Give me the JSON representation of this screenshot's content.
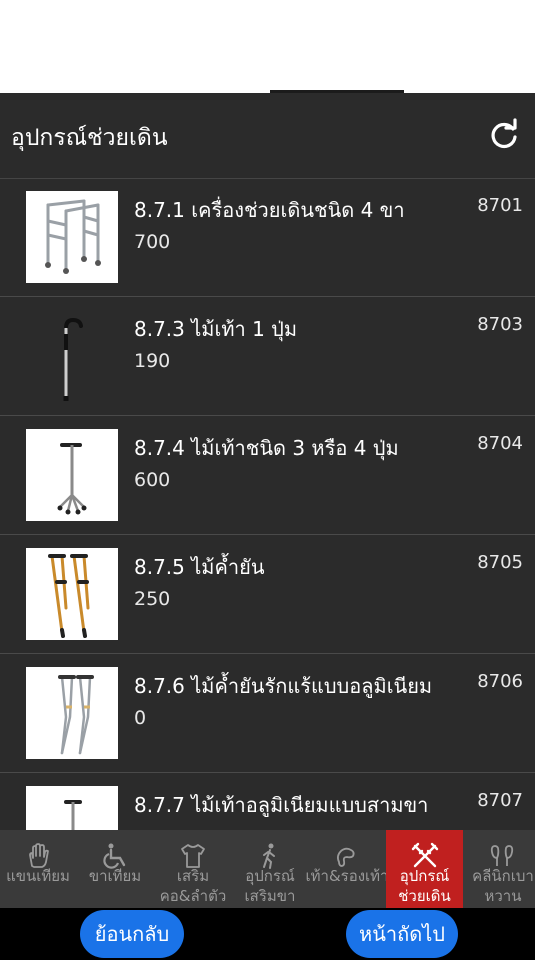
{
  "header": {
    "title": "อุปกรณ์ช่วยเดิน"
  },
  "items": [
    {
      "name": "8.7.1 เครื่องช่วยเดินชนิด 4 ขา",
      "price": "700",
      "code": "8701"
    },
    {
      "name": "8.7.3 ไม้เท้า 1 ปุ่ม",
      "price": "190",
      "code": "8703"
    },
    {
      "name": "8.7.4 ไม้เท้าชนิด 3 หรือ 4 ปุ่ม",
      "price": "600",
      "code": "8704"
    },
    {
      "name": "8.7.5 ไม้ค้ำยัน",
      "price": "250",
      "code": "8705"
    },
    {
      "name": "8.7.6 ไม้ค้ำยันรักแร้แบบอลูมิเนียม",
      "price": "0",
      "code": "8706"
    },
    {
      "name": "8.7.7 ไม้เท้าอลูมิเนียมแบบสามขา",
      "price": "",
      "code": "8707"
    }
  ],
  "tabs": [
    {
      "label1": "แขนเทียม",
      "label2": "",
      "icon": "hand-icon"
    },
    {
      "label1": "ขาเทียม",
      "label2": "",
      "icon": "wheelchair-icon"
    },
    {
      "label1": "เสริม",
      "label2": "คอ&ลำตัว",
      "icon": "shirt-icon"
    },
    {
      "label1": "อุปกรณ์",
      "label2": "เสริมขา",
      "icon": "walking-person-icon"
    },
    {
      "label1": "เท้า&รองเท้า",
      "label2": "",
      "icon": "foot-icon"
    },
    {
      "label1": "อุปกรณ์",
      "label2": "ช่วยเดิน",
      "icon": "crossed-crutches-icon",
      "active": true
    },
    {
      "label1": "คลีนิกเบา",
      "label2": "หวาน",
      "icon": "clinic-icon"
    }
  ],
  "buttons": {
    "back": "ย้อนกลับ",
    "next": "หน้าถัดไป"
  },
  "colors": {
    "panel": "#2b2b2b",
    "active_tab": "#c0201f",
    "button": "#1a73e8",
    "tabbar": "#3a3a3a"
  }
}
